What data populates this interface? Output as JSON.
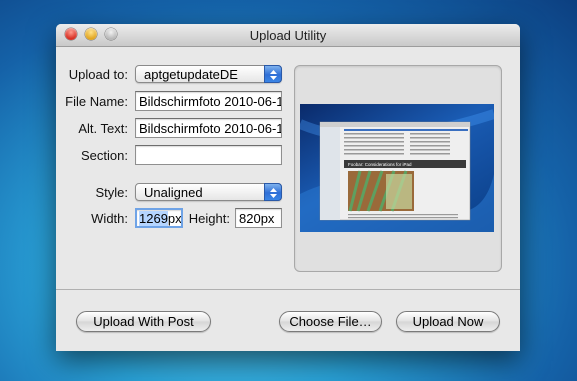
{
  "window": {
    "title": "Upload Utility"
  },
  "form": {
    "upload_to": {
      "label": "Upload to:",
      "value": "aptgetupdateDE"
    },
    "file_name": {
      "label": "File Name:",
      "value": "Bildschirmfoto 2010-06-1"
    },
    "alt_text": {
      "label": "Alt. Text:",
      "value": "Bildschirmfoto 2010-06-1"
    },
    "section": {
      "label": "Section:",
      "value": ""
    },
    "style": {
      "label": "Style:",
      "value": "Unaligned"
    },
    "width": {
      "label": "Width:",
      "value": "1269",
      "unit": "px"
    },
    "height": {
      "label": "Height:",
      "value": "820px"
    }
  },
  "buttons": {
    "upload_with_post": "Upload With Post",
    "choose_file": "Choose File…",
    "upload_now": "Upload Now"
  },
  "preview": {
    "thumbnail_heading": "Foobar: Considerations for iPad"
  }
}
